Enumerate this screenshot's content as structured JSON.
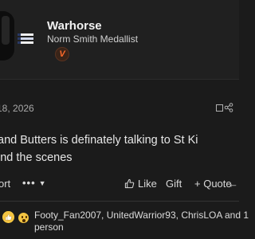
{
  "author": {
    "name": "Warhorse",
    "title": "Norm Smith Medallist",
    "badge_text": "V",
    "avatar_icon": "avatar-photo",
    "club_icon": "club-badge-icon"
  },
  "post": {
    "date": "18, 2026",
    "message_line1": "and Butters is definately talking to St Ki",
    "message_line2": "ind the scenes"
  },
  "actions": {
    "report": "ort",
    "more_dots": "•••",
    "like": "Like",
    "gift": "Gift",
    "quote": "+ Quote",
    "reply": "←"
  },
  "reactions": {
    "line1": "Footy_Fan2007, UnitedWarrior93, ChrisLOA and 1",
    "line2": "person",
    "icons": [
      "thumbs-up-icon",
      "wow-face-icon"
    ]
  },
  "colors": {
    "background": "#1b1b1b",
    "header_background": "#202020",
    "rank_accent": "#ff6a2a"
  }
}
